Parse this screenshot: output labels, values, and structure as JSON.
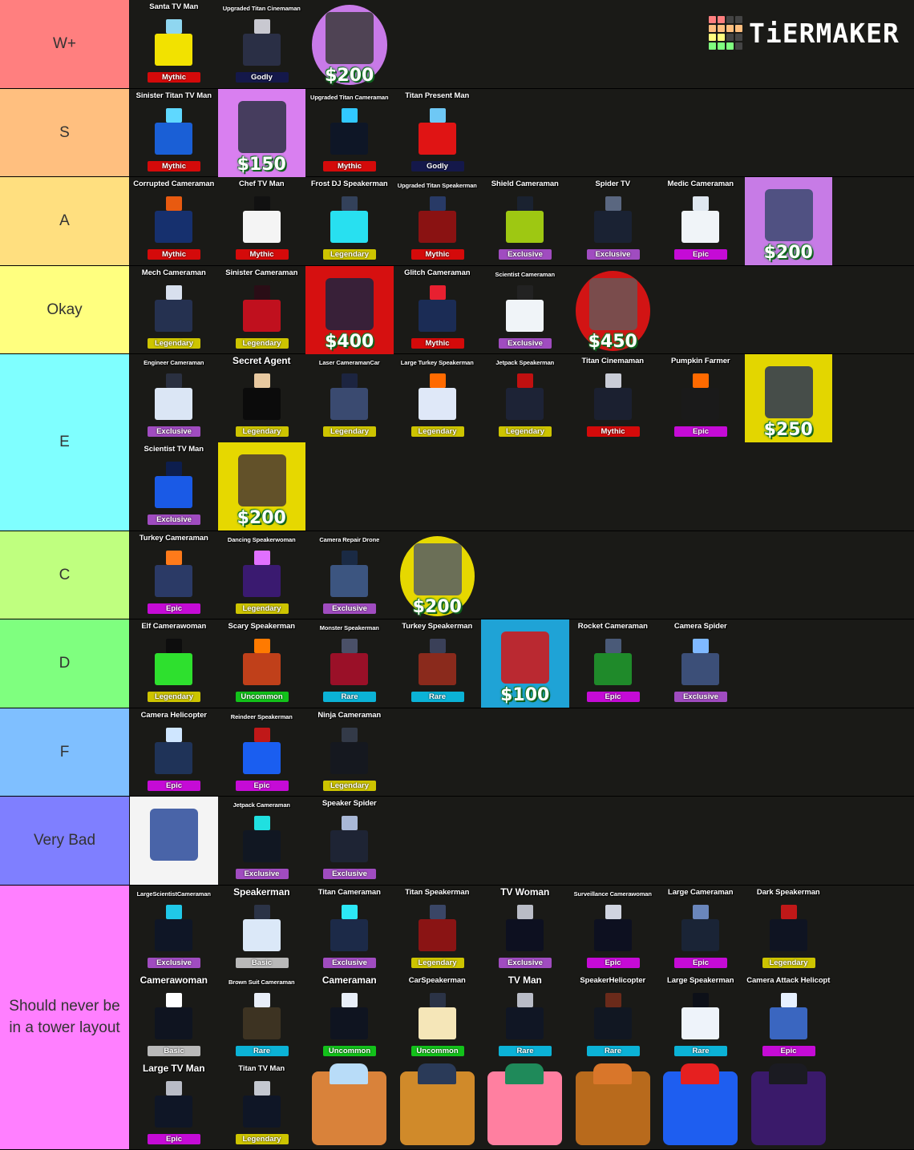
{
  "logo": {
    "text": "TiERMAKER",
    "grid_colors": [
      "#ff7f7f",
      "#ff7f7f",
      "#444",
      "#444",
      "#ffbf7f",
      "#ffbf7f",
      "#ffbf7f",
      "#ffbf7f",
      "#ffff7f",
      "#ffff7f",
      "#444",
      "#444",
      "#7fff7f",
      "#7fff7f",
      "#7fff7f",
      "#444"
    ]
  },
  "rarity_colors": {
    "Mythic": "#d40a0a",
    "Godly": "#14184a",
    "Legendary": "#cdc400",
    "Exclusive": "#a04cc0",
    "Epic": "#c50bd6",
    "Rare": "#0bb2d6",
    "Uncommon": "#12c21a",
    "Basic": "#b9b9b9"
  },
  "tiers": [
    {
      "label": "W+",
      "color": "#ff7f7f",
      "lines": 1,
      "items": [
        {
          "name": "Santa TV Man",
          "rarity": "Mythic",
          "art": [
            "#f2e200",
            "#8fd6f0"
          ]
        },
        {
          "name": "Upgraded Titan Cinemaman",
          "rarity": "Godly",
          "art": [
            "#2a2f45",
            "#c8c8d0"
          ],
          "size": "small"
        },
        {
          "type": "shop",
          "price": "$200",
          "bg": "#c87ae8",
          "shape": "circle",
          "art": "#3a3a3a"
        }
      ]
    },
    {
      "label": "S",
      "color": "#ffbf7f",
      "lines": 1,
      "items": [
        {
          "name": "Sinister Titan TV Man",
          "rarity": "Mythic",
          "art": [
            "#1a5fd6",
            "#5fd8ff"
          ]
        },
        {
          "type": "shop",
          "price": "$150",
          "bg": "#d97ff0",
          "art": "#2c3144"
        },
        {
          "name": "Upgraded Titan Cameraman",
          "rarity": "Mythic",
          "art": [
            "#0e1626",
            "#31c8ff"
          ],
          "size": "small"
        },
        {
          "name": "Titan Present Man",
          "rarity": "Godly",
          "art": [
            "#e01414",
            "#6ec8f5"
          ]
        }
      ]
    },
    {
      "label": "A",
      "color": "#ffdf7f",
      "lines": 1,
      "items": [
        {
          "name": "Corrupted Cameraman",
          "rarity": "Mythic",
          "art": [
            "#16306e",
            "#e85a10"
          ]
        },
        {
          "name": "Chef TV Man",
          "rarity": "Mythic",
          "art": [
            "#f4f4f4",
            "#111"
          ]
        },
        {
          "name": "Frost DJ Speakerman",
          "rarity": "Legendary",
          "art": [
            "#28e0f0",
            "#33415a"
          ]
        },
        {
          "name": "Upgraded Titan Speakerman",
          "rarity": "Mythic",
          "art": [
            "#8a1212",
            "#283a66"
          ],
          "size": "small"
        },
        {
          "name": "Shield Cameraman",
          "rarity": "Exclusive",
          "art": [
            "#9ec812",
            "#1a2230"
          ]
        },
        {
          "name": "Spider TV",
          "rarity": "Exclusive",
          "art": [
            "#1a2233",
            "#5a6780"
          ]
        },
        {
          "name": "Medic Cameraman",
          "rarity": "Epic",
          "art": [
            "#f0f4f8",
            "#dfe7f0"
          ]
        },
        {
          "type": "shop",
          "price": "$200",
          "bg": "#c77be6",
          "art": "#3b4a70"
        }
      ]
    },
    {
      "label": "Okay",
      "color": "#ffff7f",
      "lines": 1,
      "items": [
        {
          "name": "Mech Cameraman",
          "rarity": "Legendary",
          "art": [
            "#253150",
            "#d8e0ee"
          ]
        },
        {
          "name": "Sinister Cameraman",
          "rarity": "Legendary",
          "art": [
            "#c0101e",
            "#2a0d16"
          ]
        },
        {
          "type": "shop",
          "price": "$400",
          "bg": "#d61010",
          "art": "#1c2340"
        },
        {
          "name": "Glitch Cameraman",
          "rarity": "Mythic",
          "art": [
            "#1b2c55",
            "#e82030"
          ]
        },
        {
          "name": "Scientist Cameraman",
          "rarity": "Exclusive",
          "art": [
            "#f0f4f8",
            "#222"
          ],
          "size": "small"
        },
        {
          "type": "shop",
          "price": "$450",
          "bg": "#d21414",
          "shape": "circle",
          "art": "#6b5656"
        }
      ]
    },
    {
      "label": "E",
      "color": "#7fffff",
      "lines": 2,
      "items": [
        {
          "name": "Engineer Cameraman",
          "rarity": "Exclusive",
          "art": [
            "#dbe6f5",
            "#2a3040"
          ],
          "size": "small"
        },
        {
          "name": "Secret Agent",
          "rarity": "Legendary",
          "art": [
            "#0b0b0b",
            "#e8c9a0"
          ],
          "size": "big"
        },
        {
          "name": "Laser CameramanCar",
          "rarity": "Legendary",
          "art": [
            "#3a4a70",
            "#1c2440"
          ],
          "size": "small"
        },
        {
          "name": "Large Turkey Speakerman",
          "rarity": "Legendary",
          "art": [
            "#dfe8f8",
            "#ff6a00"
          ],
          "size": "small"
        },
        {
          "name": "Jetpack Speakerman",
          "rarity": "Legendary",
          "art": [
            "#1d2336",
            "#c01010"
          ],
          "size": "small"
        },
        {
          "name": "Titan Cinemaman",
          "rarity": "Mythic",
          "art": [
            "#1b2030",
            "#c9ccd6"
          ]
        },
        {
          "name": "Pumpkin Farmer",
          "rarity": "Epic",
          "art": [
            "#1a1a1a",
            "#ff6a00"
          ]
        },
        {
          "type": "shop",
          "price": "$250",
          "bg": "#e3d600",
          "art": "#2a3556"
        },
        {
          "name": "Scientist TV Man",
          "rarity": "Exclusive",
          "art": [
            "#1a5ae6",
            "#0d1e4e"
          ]
        },
        {
          "type": "shop",
          "price": "$200",
          "bg": "#e6d800",
          "art": "#4a3a30"
        }
      ]
    },
    {
      "label": "C",
      "color": "#bfff7f",
      "lines": 1,
      "items": [
        {
          "name": "Turkey Cameraman",
          "rarity": "Epic",
          "art": [
            "#2b3a66",
            "#ff7a1a"
          ]
        },
        {
          "name": "Dancing Speakerwoman",
          "rarity": "Legendary",
          "art": [
            "#3a1a70",
            "#e070ff"
          ],
          "size": "small"
        },
        {
          "name": "Camera Repair Drone",
          "rarity": "Exclusive",
          "art": [
            "#3c5580",
            "#1a2a44"
          ],
          "size": "small"
        },
        {
          "type": "shop",
          "price": "$200",
          "bg": "#e6d800",
          "shape": "circle",
          "art": "#555d66"
        }
      ]
    },
    {
      "label": "D",
      "color": "#7fff7f",
      "lines": 1,
      "items": [
        {
          "name": "Elf Camerawoman",
          "rarity": "Legendary",
          "art": [
            "#2ee02e",
            "#0d0d0d"
          ]
        },
        {
          "name": "Scary Speakerman",
          "rarity": "Uncommon",
          "art": [
            "#c0401a",
            "#ff7a00"
          ]
        },
        {
          "name": "Monster Speakerman",
          "rarity": "Rare",
          "art": [
            "#9a1028",
            "#4a5068"
          ],
          "size": "small"
        },
        {
          "name": "Turkey Speakerman",
          "rarity": "Rare",
          "art": [
            "#8a2a1c",
            "#3a4058"
          ]
        },
        {
          "type": "shop",
          "price": "$100",
          "bg": "#1fa3d6",
          "art": "#d61414"
        },
        {
          "name": "Rocket Cameraman",
          "rarity": "Epic",
          "art": [
            "#1f8a2a",
            "#4a5a78"
          ]
        },
        {
          "name": "Camera Spider",
          "rarity": "Exclusive",
          "art": [
            "#3c4f78",
            "#7fb8ff"
          ]
        }
      ]
    },
    {
      "label": "F",
      "color": "#7fbfff",
      "lines": 1,
      "items": [
        {
          "name": "Camera Helicopter",
          "rarity": "Epic",
          "art": [
            "#1f3358",
            "#cfe6ff"
          ]
        },
        {
          "name": "Reindeer Speakerman",
          "rarity": "Epic",
          "art": [
            "#1a5ef0",
            "#c01818"
          ],
          "size": "small"
        },
        {
          "name": "Ninja Cameraman",
          "rarity": "Legendary",
          "art": [
            "#15181f",
            "#333a48"
          ]
        }
      ]
    },
    {
      "label": "Very Bad",
      "color": "#7f7fff",
      "lines": 1,
      "items": [
        {
          "type": "shop",
          "price": "",
          "bg": "#f4f4f4",
          "art": "#2a4a9a"
        },
        {
          "name": "Jetpack Cameraman",
          "rarity": "Exclusive",
          "art": [
            "#111722",
            "#20e0e0"
          ],
          "size": "small"
        },
        {
          "name": "Speaker Spider",
          "rarity": "Exclusive",
          "art": [
            "#1e2434",
            "#a9b8d6"
          ]
        }
      ]
    },
    {
      "label": "Should never be in a tower layout",
      "color": "#ff7fff",
      "lines": 3,
      "items": [
        {
          "name": "LargeScientistCameraman",
          "rarity": "Exclusive",
          "art": [
            "#0f1626",
            "#20c8e8"
          ],
          "size": "small"
        },
        {
          "name": "Speakerman",
          "rarity": "Basic",
          "art": [
            "#dbe8f8",
            "#2b3346"
          ],
          "size": "big"
        },
        {
          "name": "Titan Cameraman",
          "rarity": "Exclusive",
          "art": [
            "#1c2a48",
            "#2ce8f6"
          ]
        },
        {
          "name": "Titan Speakerman",
          "rarity": "Legendary",
          "art": [
            "#8a1414",
            "#3a4666"
          ]
        },
        {
          "name": "TV Woman",
          "rarity": "Exclusive",
          "art": [
            "#0d1020",
            "#b9bcc6"
          ],
          "size": "big"
        },
        {
          "name": "Surveillance Camerawoman",
          "rarity": "Epic",
          "art": [
            "#0d1020",
            "#d0d4e0"
          ],
          "size": "small"
        },
        {
          "name": "Large Cameraman",
          "rarity": "Epic",
          "art": [
            "#1a2436",
            "#6a86bb"
          ]
        },
        {
          "name": "Dark Speakerman",
          "rarity": "Legendary",
          "art": [
            "#0f1422",
            "#c01818"
          ]
        },
        {
          "name": "Camerawoman",
          "rarity": "Basic",
          "art": [
            "#0f1420",
            "#ffffff"
          ],
          "size": "big"
        },
        {
          "name": "Brown Suit Cameraman",
          "rarity": "Rare",
          "art": [
            "#3d3322",
            "#e8eef8"
          ],
          "size": "small"
        },
        {
          "name": "Cameraman",
          "rarity": "Uncommon",
          "art": [
            "#0f1420",
            "#e8eef8"
          ],
          "size": "big"
        },
        {
          "name": "CarSpeakerman",
          "rarity": "Uncommon",
          "art": [
            "#f5e6b8",
            "#2b3346"
          ]
        },
        {
          "name": "TV Man",
          "rarity": "Rare",
          "art": [
            "#101624",
            "#b9bcc6"
          ],
          "size": "big"
        },
        {
          "name": "SpeakerHelicopter",
          "rarity": "Rare",
          "art": [
            "#111722",
            "#6a2a1a"
          ]
        },
        {
          "name": "Large Speakerman",
          "rarity": "Rare",
          "art": [
            "#eef3fa",
            "#0d1018"
          ]
        },
        {
          "name": "Camera Attack Helicopt",
          "rarity": "Epic",
          "art": [
            "#3a66c0",
            "#e6f0ff"
          ]
        },
        {
          "name": "Large TV Man",
          "rarity": "Epic",
          "art": [
            "#0f1626",
            "#b9bcc6"
          ],
          "size": "big"
        },
        {
          "name": "Titan TV Man",
          "rarity": "Legendary",
          "art": [
            "#0f1626",
            "#c4c8d0"
          ]
        },
        {
          "type": "chest",
          "bg": "#d9823a",
          "top": "#b8dcf8"
        },
        {
          "type": "chest",
          "bg": "#d08a2a",
          "top": "#2a3a58"
        },
        {
          "type": "chest",
          "bg": "#ff7fa0",
          "top": "#1f8a5a"
        },
        {
          "type": "chest",
          "bg": "#b86a1c",
          "top": "#d9762a"
        },
        {
          "type": "chest",
          "bg": "#1e5ef0",
          "top": "#e62020"
        },
        {
          "type": "chest",
          "bg": "#3a1a6a",
          "top": "#1b1b22"
        }
      ]
    }
  ]
}
